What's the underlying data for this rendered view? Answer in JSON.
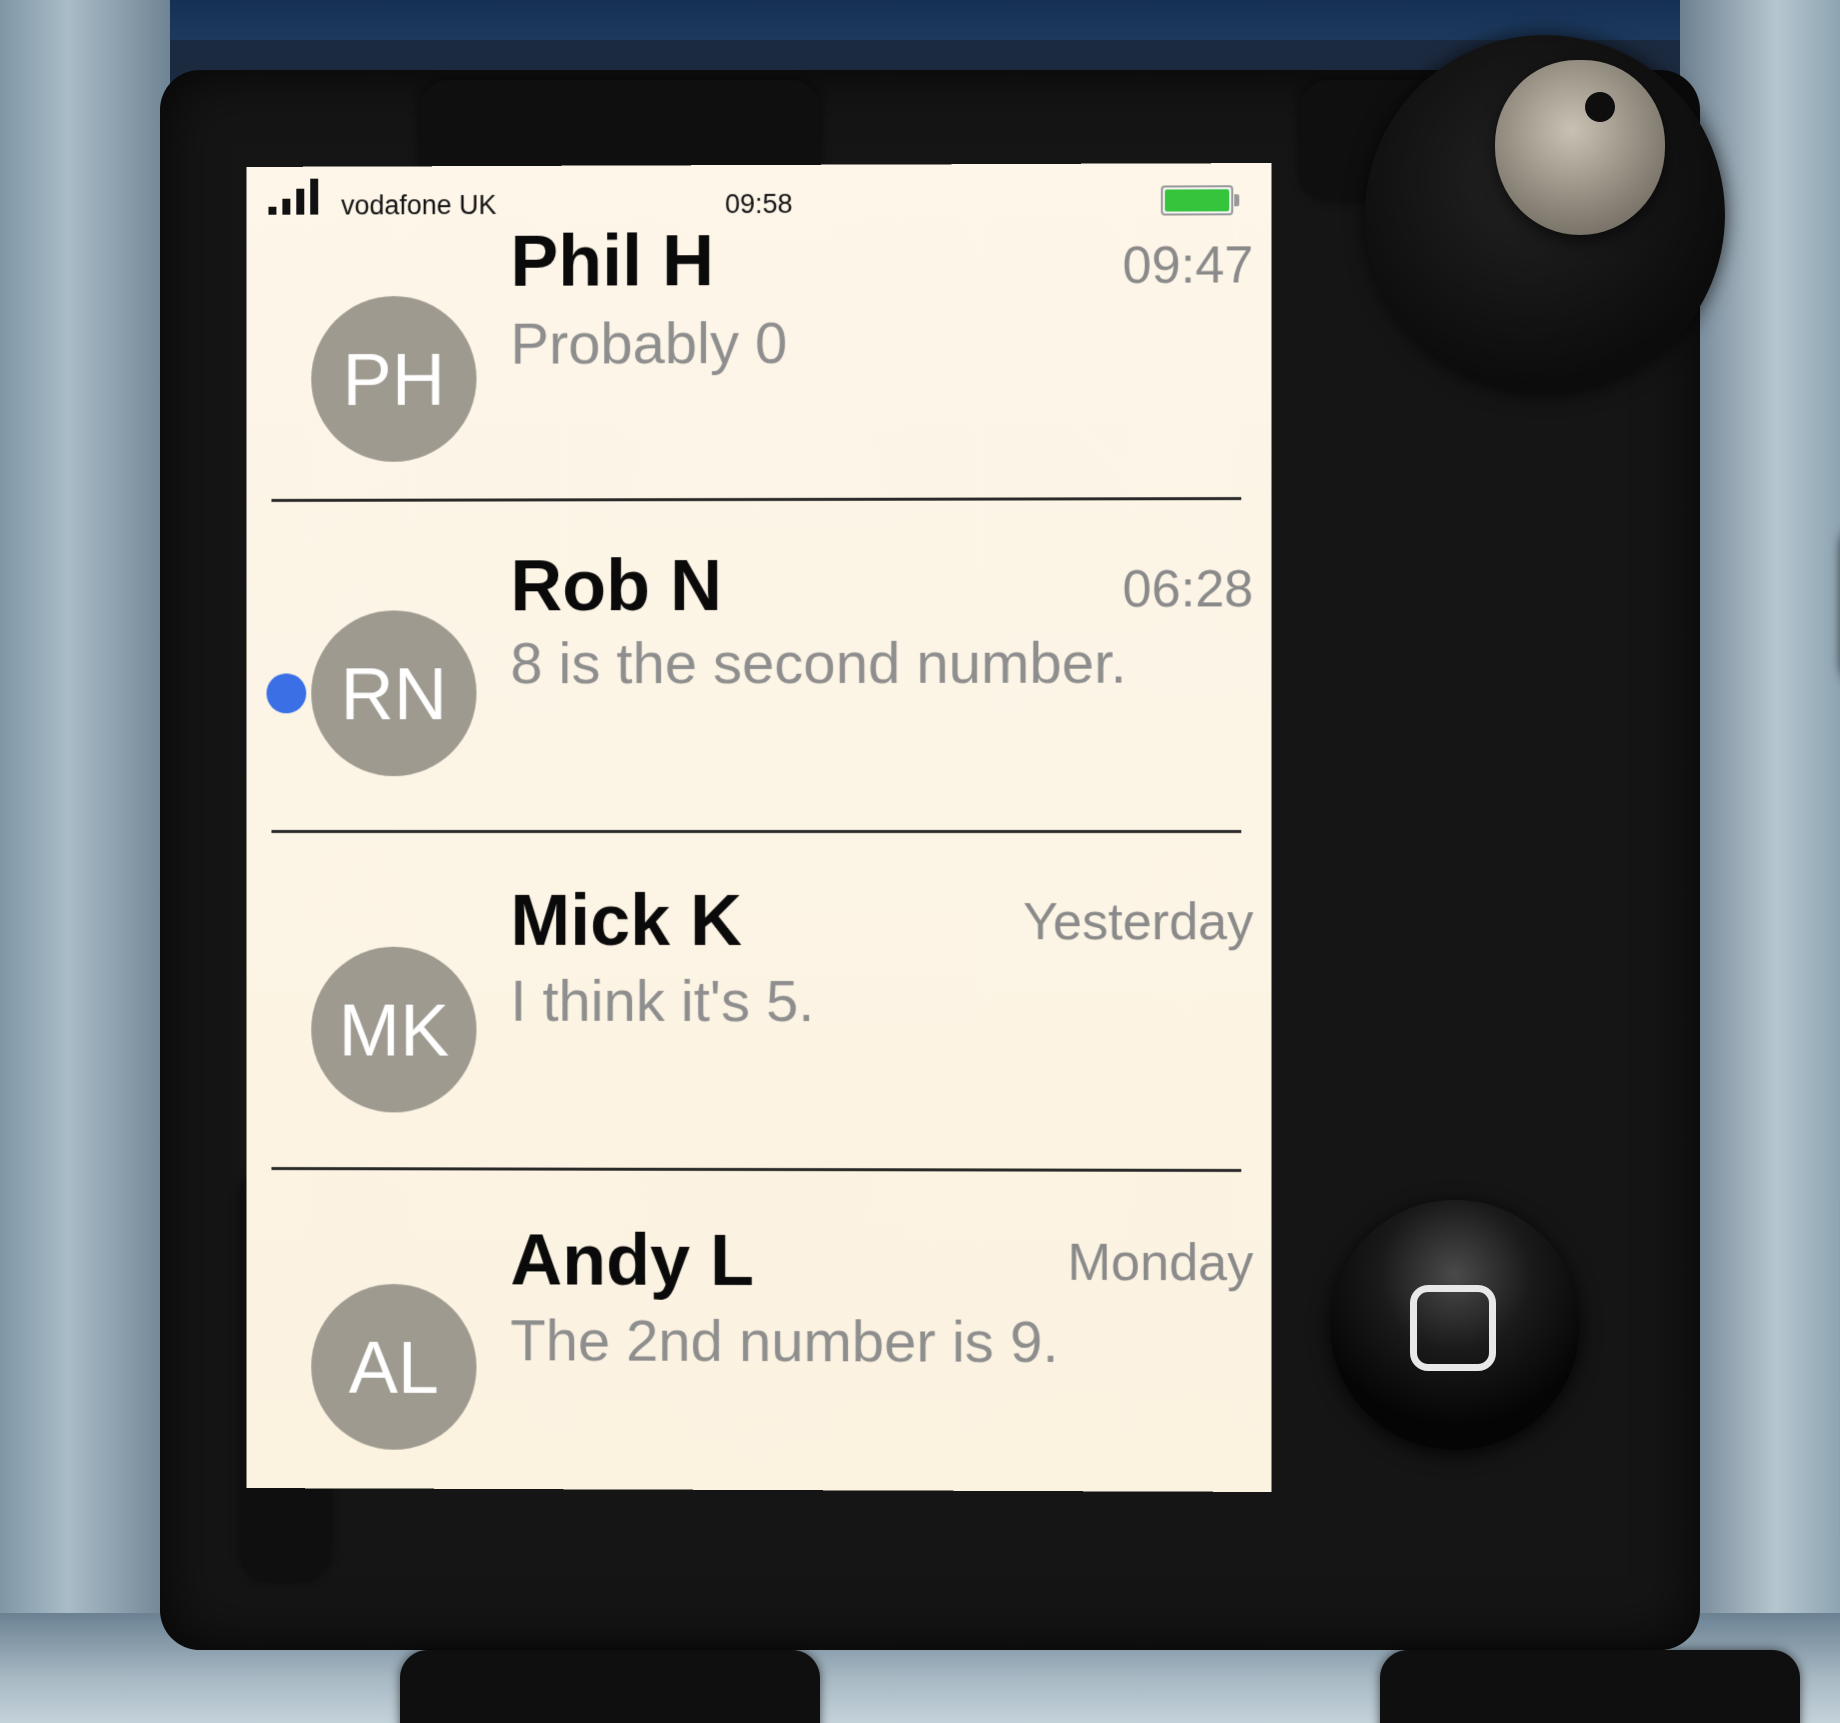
{
  "status_bar": {
    "carrier": "vodafone UK",
    "time": "09:58",
    "battery_level": 1.0
  },
  "conversations": [
    {
      "initials": "PH",
      "name": "Phil H",
      "time": "09:47",
      "preview": "Probably 0",
      "unread": false
    },
    {
      "initials": "RN",
      "name": "Rob N",
      "time": "06:28",
      "preview": "8 is the second number.",
      "unread": true
    },
    {
      "initials": "MK",
      "name": "Mick K",
      "time": "Yesterday",
      "preview": "I think it's 5.",
      "unread": false
    },
    {
      "initials": "AL",
      "name": "Andy L",
      "time": "Monday",
      "preview": "The 2nd number is 9.",
      "unread": false
    }
  ],
  "colors": {
    "unread_dot": "#3a6fe6",
    "battery": "#35c43c",
    "avatar": "#9e9a90"
  },
  "icons": {
    "signal": "signal-bars-icon",
    "battery": "battery-icon",
    "home": "home-square-icon"
  }
}
